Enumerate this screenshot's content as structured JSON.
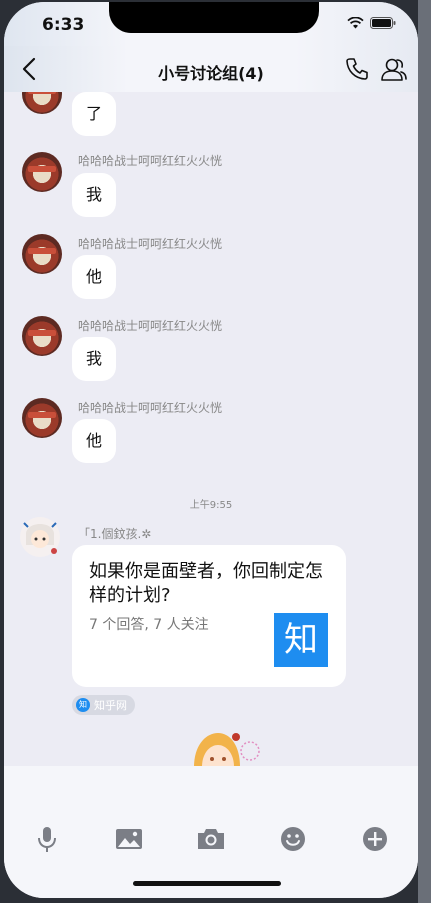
{
  "status_bar": {
    "time": "6:33"
  },
  "header": {
    "title": "小号讨论组(4)"
  },
  "messages": [
    {
      "text": "了"
    },
    {
      "sender": "哈哈哈战士呵呵红红火火恍",
      "text": "我"
    },
    {
      "sender": "哈哈哈战士呵呵红红火火恍",
      "text": "他"
    },
    {
      "sender": "哈哈哈战士呵呵红红火火恍",
      "text": "我"
    },
    {
      "sender": "哈哈哈战士呵呵红红火火恍",
      "text": "他"
    }
  ],
  "timestamp": "上午9:55",
  "share": {
    "sender": "「1.個鈫孩.✲",
    "title": "如果你是面壁者，你回制定怎样的计划?",
    "meta": "7 个回答, 7 人关注",
    "logo_text": "知",
    "source_icon_text": "知",
    "source_label": "知乎网"
  },
  "colors": {
    "zhihu_blue": "#1e8df0",
    "chat_bg": "#ececf4"
  },
  "icons": [
    "back-icon",
    "phone-icon",
    "contacts-icon",
    "mic-icon",
    "image-icon",
    "camera-icon",
    "emoji-icon",
    "plus-icon"
  ]
}
